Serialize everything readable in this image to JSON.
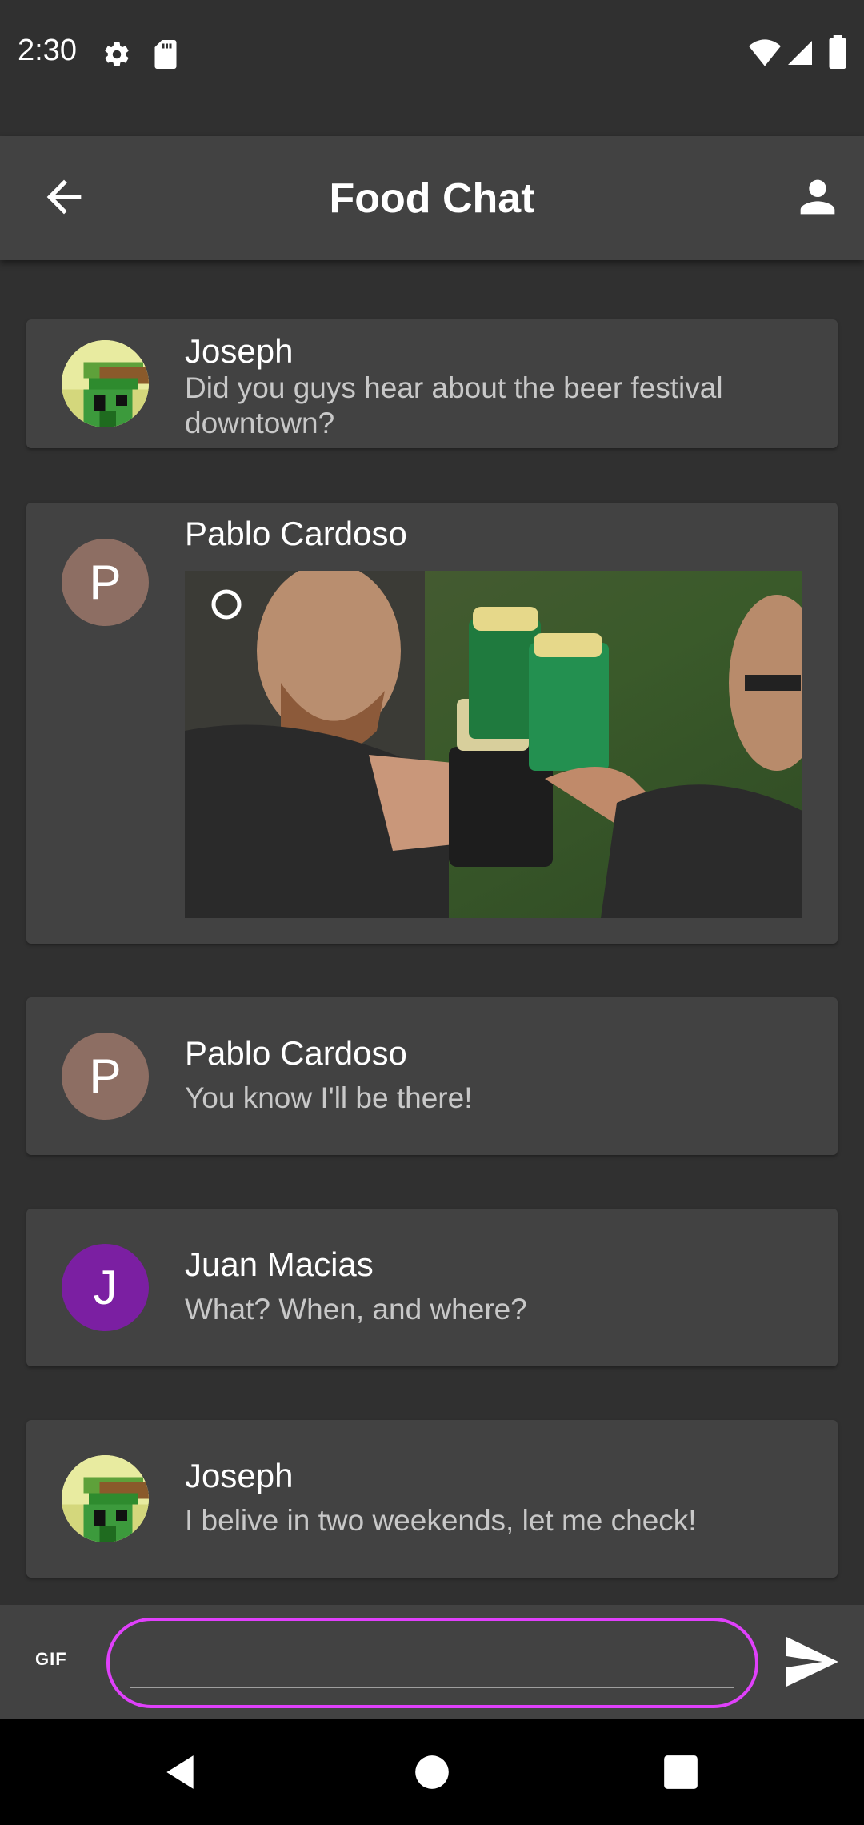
{
  "status_bar": {
    "time": "2:30",
    "icons": [
      "gear-icon",
      "sd-card-icon",
      "wifi-icon",
      "signal-icon",
      "battery-icon"
    ]
  },
  "app_bar": {
    "title": "Food Chat",
    "back_icon": "arrow-back-icon",
    "profile_icon": "person-icon"
  },
  "messages": [
    {
      "sender": "Joseph",
      "text": "Did you guys hear about the beer festival downtown?",
      "avatar": "image"
    },
    {
      "sender": "Pablo Cardoso",
      "text": "",
      "avatar": "P",
      "attachment": "gif"
    },
    {
      "sender": "Pablo Cardoso",
      "text": "You know I'll be there!",
      "avatar": "P"
    },
    {
      "sender": "Juan Macias",
      "text": "What? When, and where?",
      "avatar": "J"
    },
    {
      "sender": "Joseph",
      "text": "I belive in two weekends, let me check!",
      "avatar": "image"
    }
  ],
  "composer": {
    "gif_label": "GIF",
    "input_value": "",
    "input_placeholder": "",
    "send_icon": "send-icon"
  },
  "nav_bar": {
    "icons": [
      "nav-back-icon",
      "nav-home-icon",
      "nav-recents-icon"
    ]
  },
  "colors": {
    "background": "#303030",
    "surface": "#424242",
    "accent": "#e040fb",
    "avatar_p": "#8d6e63",
    "avatar_j": "#7b1fa2"
  }
}
